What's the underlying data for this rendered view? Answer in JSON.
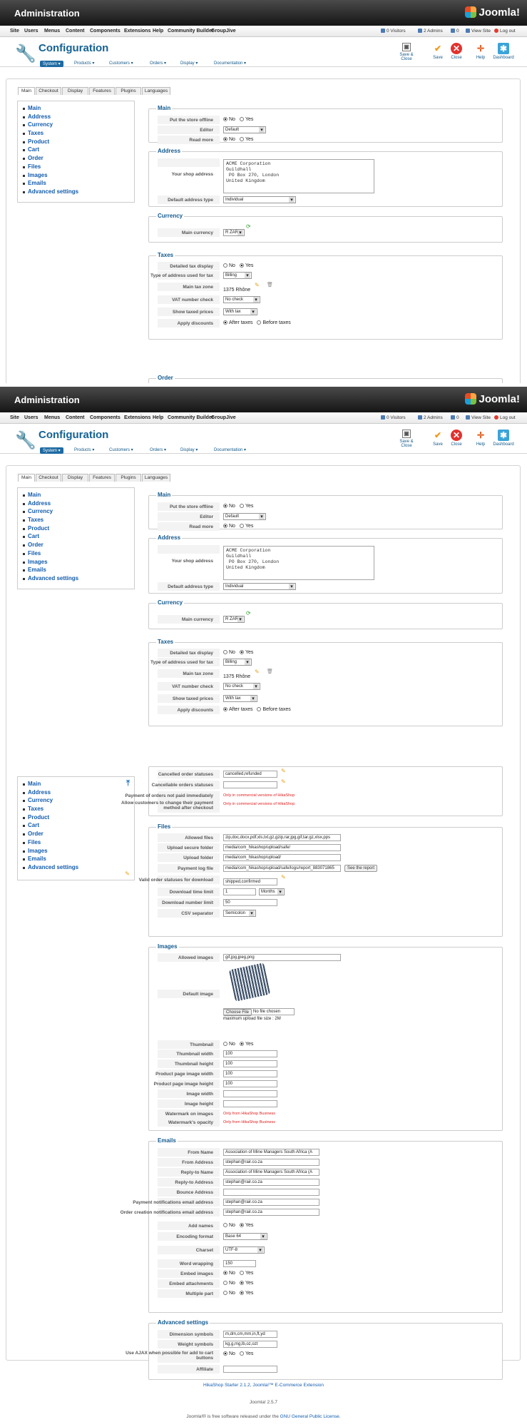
{
  "admin_title": "Administration",
  "joomla_logo": "Joomla!",
  "menu": [
    "Site",
    "Users",
    "Menus",
    "Content",
    "Components",
    "Extensions",
    "Help",
    "Community Builder",
    "GroupJive"
  ],
  "status": {
    "visitors": "0 Visitors",
    "admins": "2 Admins",
    "messages": "0",
    "view_site": "View Site",
    "logout": "Log out"
  },
  "page_title": "Configuration",
  "subnav": [
    "System ▾",
    "Products ▾",
    "Customers ▾",
    "Orders ▾",
    "Display ▾",
    "Documentation ▾"
  ],
  "toolbar": [
    "Save & Close",
    "Save",
    "Close",
    "Help",
    "Dashboard"
  ],
  "tabs": [
    "Main",
    "Checkout",
    "Display",
    "Features",
    "Plugins",
    "Languages"
  ],
  "left_menu": [
    "Main",
    "Address",
    "Currency",
    "Taxes",
    "Product",
    "Cart",
    "Order",
    "Files",
    "Images",
    "Emails",
    "Advanced settings"
  ],
  "main": {
    "legend": "Main",
    "offline_label": "Put the store offline",
    "no": "No",
    "yes": "Yes",
    "editor_label": "Editor",
    "editor_value": "Default",
    "readmore_label": "Read more"
  },
  "address": {
    "legend": "Address",
    "shop_label": "Your shop address",
    "shop_value": "ACME Corporation\nGuildhall\n PO Box 270, London\nUnited Kingdom",
    "type_label": "Default address type",
    "type_value": "Individual"
  },
  "currency": {
    "legend": "Currency",
    "label": "Main currency",
    "value": "R ZAR"
  },
  "taxes": {
    "legend": "Taxes",
    "detailed": "Detailed tax display",
    "addr_type": "Type of address used for tax",
    "addr_value": "Billing",
    "zone": "Main tax zone",
    "zone_value": "1375 Rhône",
    "vat": "VAT number check",
    "vat_value": "No check",
    "show": "Show taxed prices",
    "show_value": "With tax",
    "apply": "Apply discounts",
    "after": "After taxes",
    "before": "Before taxes"
  },
  "order": {
    "cancelled": "Cancelled order statuses",
    "cancelled_value": "cancelled,refunded",
    "cancellable": "Cancellable orders statuses",
    "not_paid": "Payment of orders not paid immediately",
    "allow_change": "Allow customers to change their payment method after checkout",
    "only_commercial": "Only in commercial versions of HikaShop"
  },
  "files": {
    "legend": "Files",
    "allowed": "Allowed files",
    "allowed_value": "zip,doc,docx,pdf,xls,txt,gz,gzip,rar,jpg,gif,tar.gz,xlsx,pps",
    "secure": "Upload secure folder",
    "secure_value": "media/com_hikashop/upload/safe/",
    "upload": "Upload folder",
    "upload_value": "media/com_hikashop/upload/",
    "paylog": "Payment log file",
    "paylog_value": "media/com_hikashop/upload/safe/logs/report_883071865",
    "see_report": "See the report",
    "valid": "Valid order statuses for download",
    "valid_value": "shipped,confirmed",
    "time": "Download time limit",
    "time_value": "1",
    "time_unit": "Months",
    "number": "Download number limit",
    "number_value": "50",
    "csv": "CSV separator",
    "csv_value": "Semicolon"
  },
  "images": {
    "legend": "Images",
    "allowed": "Allowed images",
    "allowed_value": "gif,jpg,jpeg,png",
    "default": "Default image",
    "choose": "Choose File",
    "no_file": "No file chosen",
    "max": "maximum upload file size : 2M",
    "thumb": "Thumbnail",
    "tw": "Thumbnail width",
    "tw_v": "100",
    "th": "Thumbnail height",
    "th_v": "100",
    "pw": "Product page image width",
    "pw_v": "100",
    "ph": "Product page image height",
    "ph_v": "100",
    "iw": "Image width",
    "ih": "Image height",
    "wm": "Watermark on images",
    "wo": "Watermark's opacity",
    "only_business": "Only from HikaShop Business"
  },
  "emails": {
    "legend": "Emails",
    "from_name": "From Name",
    "from_name_v": "Association of Mine Managers South Africa (A",
    "from_addr": "From Address",
    "from_addr_v": "stephan@rair.co.za",
    "reply_name": "Reply-to Name",
    "reply_name_v": "Association of Mine Managers South Africa (A",
    "reply_addr": "Reply-to Address",
    "reply_addr_v": "stephan@rair.co.za",
    "bounce": "Bounce Address",
    "pay_notif": "Payment notifications email address",
    "pay_notif_v": "stephan@rair.co.za",
    "order_notif": "Order creation notifications email address",
    "order_notif_v": "stephan@rair.co.za",
    "add_names": "Add names",
    "encoding": "Encoding format",
    "encoding_v": "Base 64",
    "charset": "Charset",
    "charset_v": "UTF-8",
    "wrap": "Word wrapping",
    "wrap_v": "150",
    "embed_img": "Embed images",
    "embed_att": "Embed attachments",
    "multipart": "Multiple part"
  },
  "advanced": {
    "legend": "Advanced settings",
    "dim": "Dimension symbols",
    "dim_v": "m,dm,cm,mm,in,ft,yd",
    "weight": "Weight symbols",
    "weight_v": "kg,g,mg,lb,oz,ozt",
    "ajax": "Use AJAX when possible for add to cart buttons",
    "affiliate": "Affiliate"
  },
  "footer": {
    "version_line": "HikaShop Starter 2.1.2, Joomla!™ E-Commerce Extension",
    "joomla_version": "Joomla! 2.5.7",
    "license_pre": "Joomla!® is free software released under the",
    "license_link": "GNU General Public License."
  }
}
